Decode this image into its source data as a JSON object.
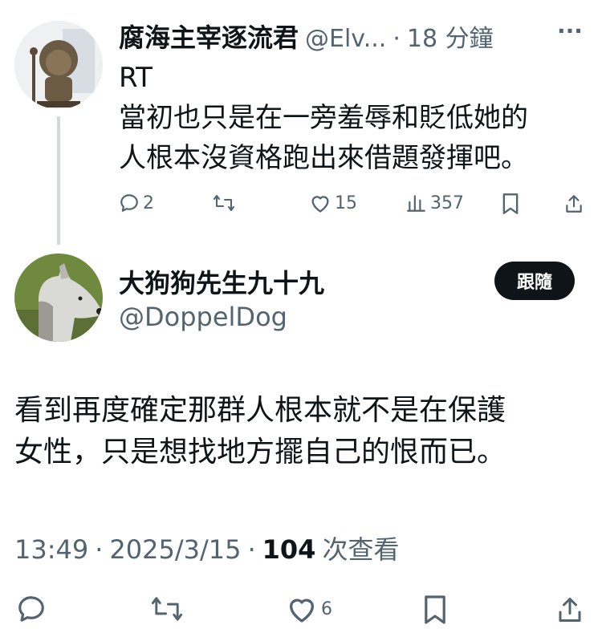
{
  "reply_tweet": {
    "display_name": "腐海主宰逐流君",
    "handle": "@Elv...",
    "dot": "·",
    "time": "18 分鐘",
    "more": "···",
    "text_line1": "RT",
    "text_line2": "當初也只是在一旁羞辱和貶低她的",
    "text_line3": "人根本沒資格跑出來借題發揮吧。",
    "actions": {
      "replies": "2",
      "retweets": "",
      "likes": "15",
      "views": "357"
    }
  },
  "main_tweet": {
    "display_name": "大狗狗先生九十九",
    "handle": "@DoppelDog",
    "follow_label": "跟隨",
    "text_line1": "看到再度確定那群人根本就不是在保護",
    "text_line2": "女性，只是想找地方擺自己的恨而已。",
    "meta": {
      "time": "13:49",
      "sep1": "·",
      "date": "2025/3/15",
      "sep2": "·",
      "views_count": "104",
      "views_label": "次查看"
    },
    "actions": {
      "replies": "",
      "retweets": "",
      "likes": "6"
    }
  },
  "colors": {
    "text": "#0f1419",
    "muted": "#536471",
    "line": "#cfd9de",
    "button_bg": "#0f1419"
  }
}
